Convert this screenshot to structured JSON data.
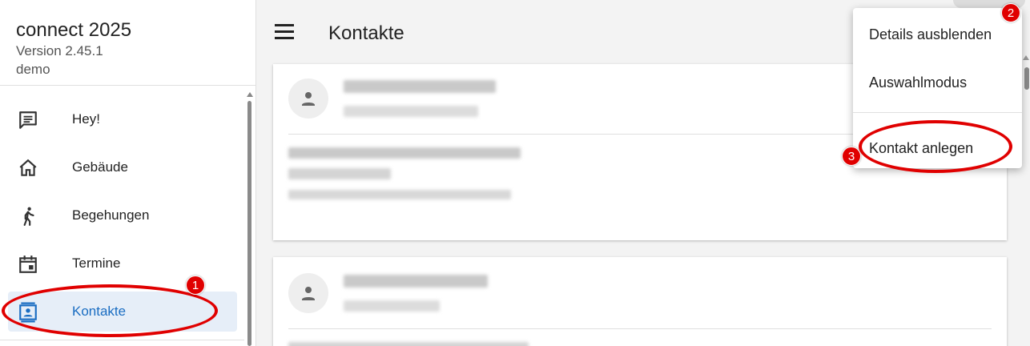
{
  "app": {
    "title": "connect 2025",
    "version": "Version 2.45.1",
    "environment": "demo"
  },
  "sidebar": {
    "items": [
      {
        "label": "Hey!",
        "icon": "chat-icon"
      },
      {
        "label": "Gebäude",
        "icon": "home-icon"
      },
      {
        "label": "Begehungen",
        "icon": "walking-icon"
      },
      {
        "label": "Termine",
        "icon": "calendar-icon"
      },
      {
        "label": "Kontakte",
        "icon": "contact-card-icon",
        "active": true
      }
    ]
  },
  "header": {
    "title": "Kontakte",
    "menu_icon": "hamburger-menu-icon"
  },
  "dropdown": {
    "items": [
      {
        "label": "Details ausblenden"
      },
      {
        "label": "Auswahlmodus"
      },
      {
        "label": "Kontakt anlegen"
      }
    ]
  },
  "annotations": {
    "badges": [
      "1",
      "2",
      "3"
    ]
  },
  "colors": {
    "accent": "#1a6dc2",
    "active_bg": "#e6eef8",
    "annotation": "#e00000"
  }
}
